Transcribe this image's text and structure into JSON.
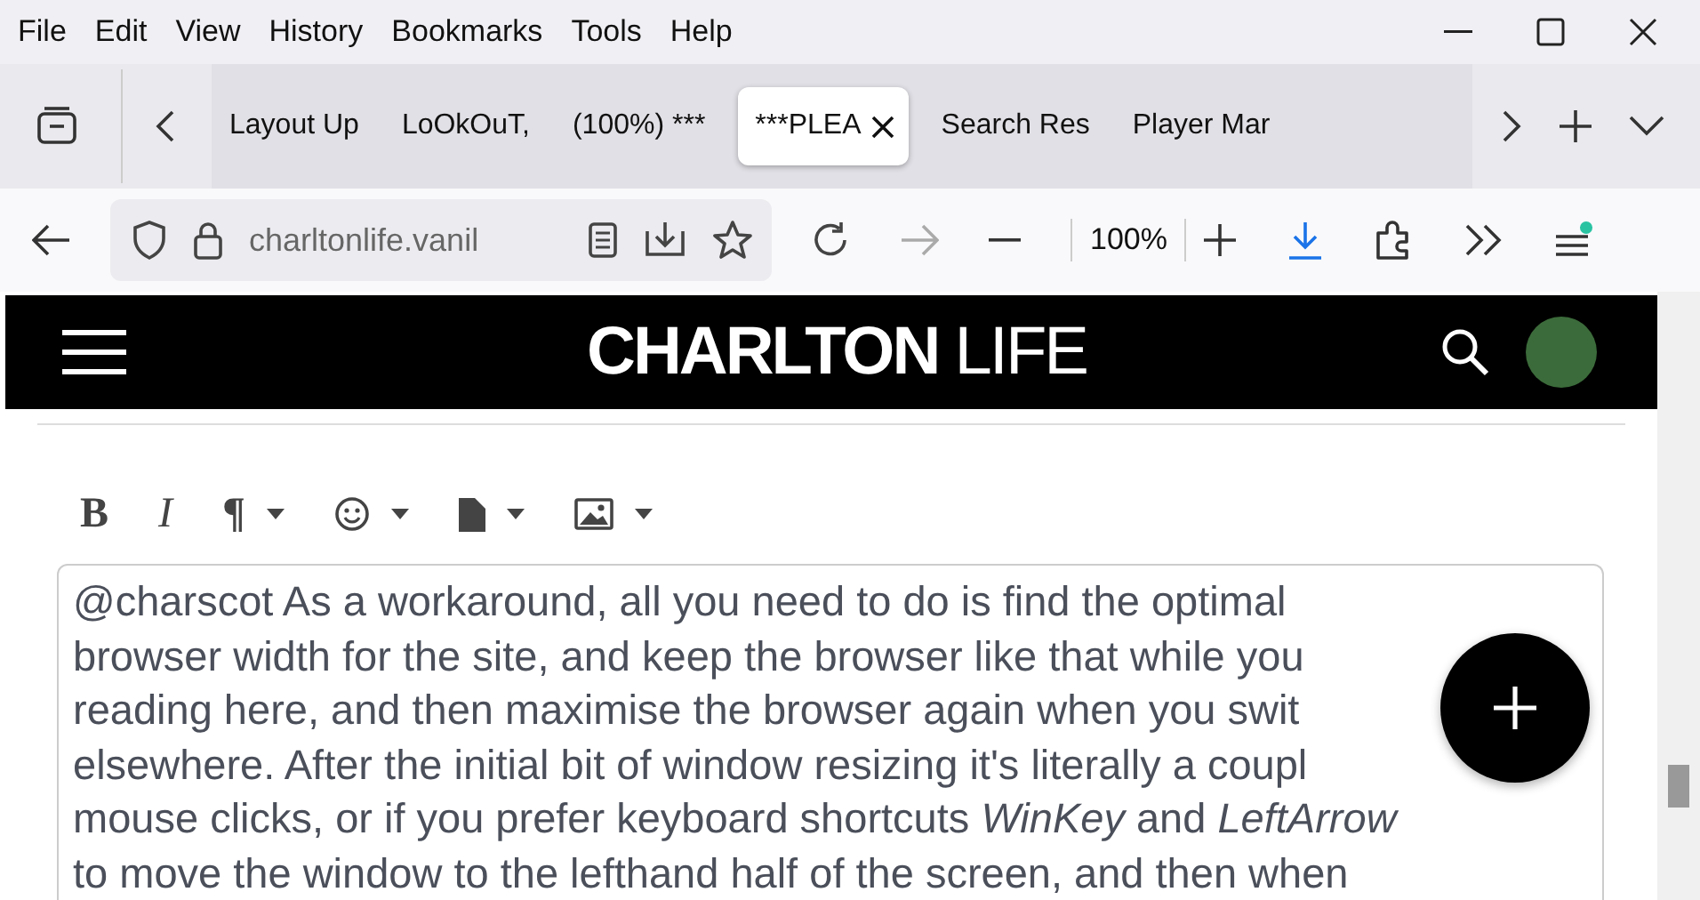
{
  "menu": [
    "File",
    "Edit",
    "View",
    "History",
    "Bookmarks",
    "Tools",
    "Help"
  ],
  "tabs": [
    {
      "title": "Layout Up",
      "selected": false
    },
    {
      "title": "LoOkOuT,",
      "selected": false
    },
    {
      "title": "(100%) ***",
      "selected": false
    },
    {
      "title": "***PLEA",
      "selected": true
    },
    {
      "title": "Search Res",
      "selected": false
    },
    {
      "title": "Player Mar",
      "selected": false
    }
  ],
  "address": {
    "url": "charltonlife.vanil"
  },
  "zoom": "100%",
  "site": {
    "logo_bold": "CHARLTON",
    "logo_light": "LIFE"
  },
  "editor_tools": [
    {
      "kind": "bold",
      "text": "B"
    },
    {
      "kind": "italic",
      "text": "I"
    },
    {
      "kind": "paragraph",
      "text": "¶"
    },
    {
      "kind": "emoji"
    },
    {
      "kind": "file"
    },
    {
      "kind": "image"
    }
  ],
  "editor_lines": [
    "@charscot As a workaround, all you need to do is find the optimal",
    "browser width for the site, and keep the browser like that while you",
    "reading here, and then maximise the browser again when you swit",
    "elsewhere. After the initial bit of window resizing it's literally a coupl",
    "mouse clicks, or if you prefer keyboard shortcuts *WinKey* and *LeftArrow*",
    "to move the window to the lefthand half of the screen, and then when"
  ]
}
